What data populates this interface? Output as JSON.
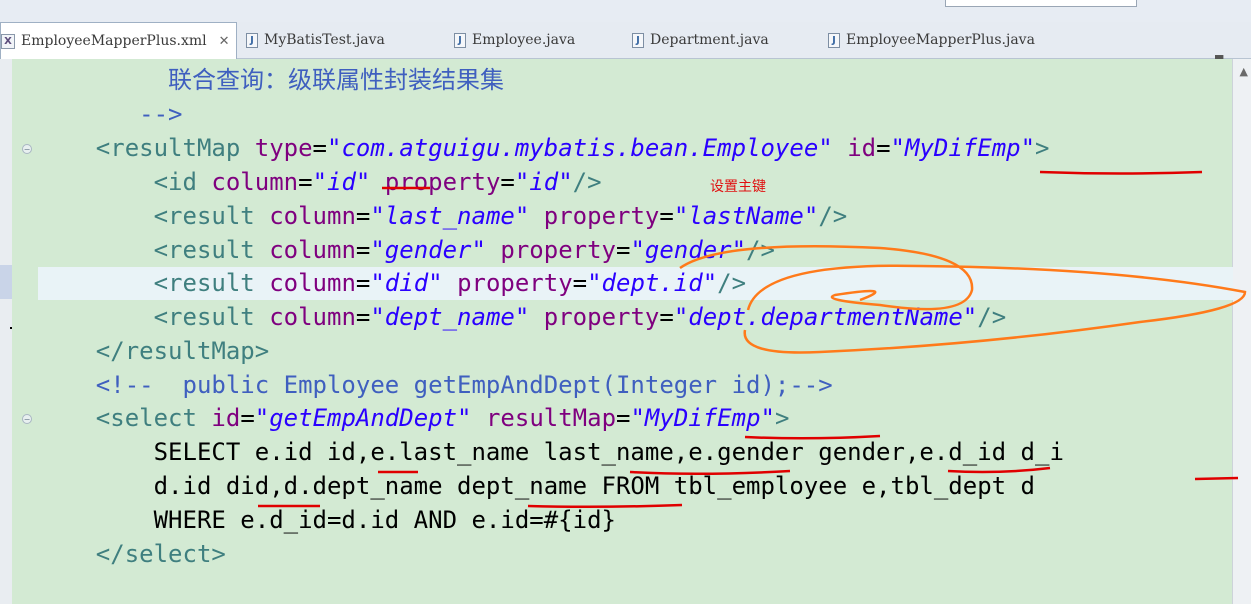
{
  "tabs": [
    {
      "label": "EmployeeMapperPlus.xml",
      "icon": "xml-file-icon",
      "active": true,
      "close": "✕"
    },
    {
      "label": "MyBatisTest.java",
      "icon": "java-file-icon",
      "active": false
    },
    {
      "label": "Employee.java",
      "icon": "java-file-icon",
      "active": false
    },
    {
      "label": "Department.java",
      "icon": "java-file-icon",
      "active": false
    },
    {
      "label": "EmployeeMapperPlus.java",
      "icon": "java-file-icon",
      "active": false
    }
  ],
  "editor": {
    "lines": {
      "l0": {
        "comment": "联合查询：级联属性封装结果集"
      },
      "l1": {
        "comment_end": "-->"
      },
      "l2": {
        "tag": "<resultMap",
        "a1": "type",
        "eq": "=",
        "v1": "\"com.atguigu.mybatis.bean.Employee\"",
        "a2": "id",
        "v2": "\"MyDifEmp\"",
        "close": ">"
      },
      "l3": {
        "tag": "<id",
        "a1": "column",
        "eq": "=",
        "v1": "\"id\"",
        "a2": "property",
        "v2": "\"id\"",
        "close": "/>"
      },
      "l4": {
        "tag": "<result",
        "a1": "column",
        "eq": "=",
        "v1": "\"last_name\"",
        "a2": "property",
        "v2": "\"lastName\"",
        "close": "/>"
      },
      "l5": {
        "tag": "<result",
        "a1": "column",
        "eq": "=",
        "v1": "\"gender\"",
        "a2": "property",
        "v2": "\"gender\"",
        "close": "/>"
      },
      "l6": {
        "tag": "<result",
        "a1": "column",
        "eq": "=",
        "v1": "\"did\"",
        "a2": "property",
        "v2": "\"dept.id\"",
        "close": "/>"
      },
      "l7": {
        "tag": "<result",
        "a1": "column",
        "eq": "=",
        "v1": "\"dept_name\"",
        "a2": "property",
        "v2": "\"dept.departmentName\"",
        "close": "/>"
      },
      "l8": {
        "tag": "</resultMap>"
      },
      "l9": {
        "comment": "<!--  public Employee getEmpAndDept(Integer id);-->"
      },
      "l10": {
        "tag": "<select",
        "a1": "id",
        "eq": "=",
        "v1": "\"getEmpAndDept\"",
        "a2": "resultMap",
        "v2": "\"MyDifEmp\"",
        "close": ">"
      },
      "l11": {
        "sql": "SELECT e.id id,e.last_name last_name,e.gender gender,e.d_id d_i"
      },
      "l12": {
        "sql": "d.id did,d.dept_name dept_name FROM tbl_employee e,tbl_dept d"
      },
      "l13": {
        "sql": "WHERE e.d_id=d.id AND e.id=#{id}"
      },
      "l14": {
        "tag": "</select>"
      }
    }
  },
  "annotation": {
    "note": "设置主键",
    "ink_color": "#ff7a1a",
    "underline_color": "#e00000"
  }
}
